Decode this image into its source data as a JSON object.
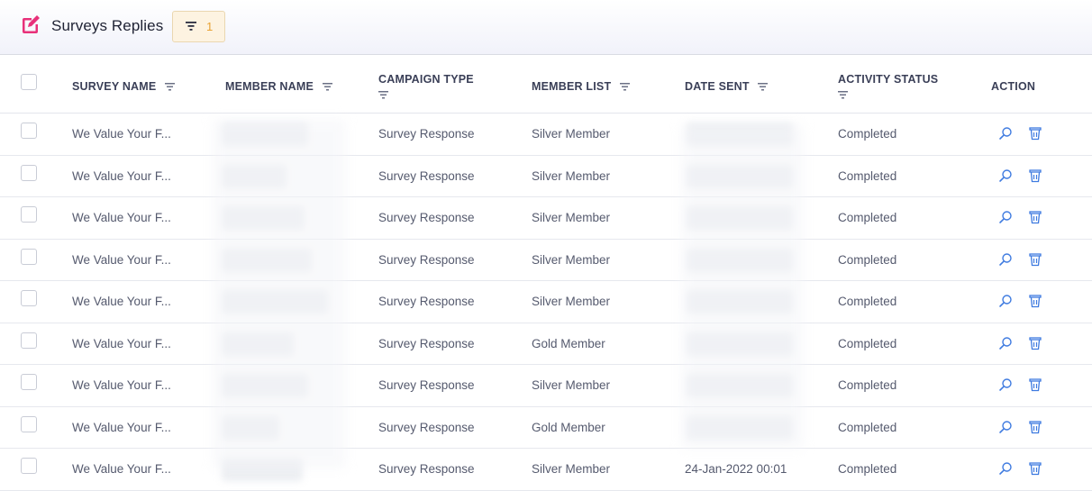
{
  "header": {
    "title": "Surveys Replies",
    "filter_count": "1",
    "accent": "#e8317a"
  },
  "columns": [
    "SURVEY NAME",
    "MEMBER NAME",
    "CAMPAIGN TYPE",
    "MEMBER LIST",
    "DATE SENT",
    "ACTIVITY STATUS",
    "ACTION"
  ],
  "rows": [
    {
      "survey": "We Value Your F...",
      "campaign": "Survey Response",
      "list": "Silver Member",
      "date": "",
      "status": "Completed"
    },
    {
      "survey": "We Value Your F...",
      "campaign": "Survey Response",
      "list": "Silver Member",
      "date": "",
      "status": "Completed"
    },
    {
      "survey": "We Value Your F...",
      "campaign": "Survey Response",
      "list": "Silver Member",
      "date": "",
      "status": "Completed"
    },
    {
      "survey": "We Value Your F...",
      "campaign": "Survey Response",
      "list": "Silver Member",
      "date": "",
      "status": "Completed"
    },
    {
      "survey": "We Value Your F...",
      "campaign": "Survey Response",
      "list": "Silver Member",
      "date": "",
      "status": "Completed"
    },
    {
      "survey": "We Value Your F...",
      "campaign": "Survey Response",
      "list": "Gold Member",
      "date": "",
      "status": "Completed"
    },
    {
      "survey": "We Value Your F...",
      "campaign": "Survey Response",
      "list": "Silver Member",
      "date": "",
      "status": "Completed"
    },
    {
      "survey": "We Value Your F...",
      "campaign": "Survey Response",
      "list": "Gold Member",
      "date": "",
      "status": "Completed"
    },
    {
      "survey": "We Value Your F...",
      "campaign": "Survey Response",
      "list": "Silver Member",
      "date": "24-Jan-2022 00:01",
      "status": "Completed"
    }
  ],
  "icons": {
    "view": "search-icon",
    "delete": "trash-icon",
    "sort": "filter-sort-icon",
    "title": "edit-icon"
  }
}
